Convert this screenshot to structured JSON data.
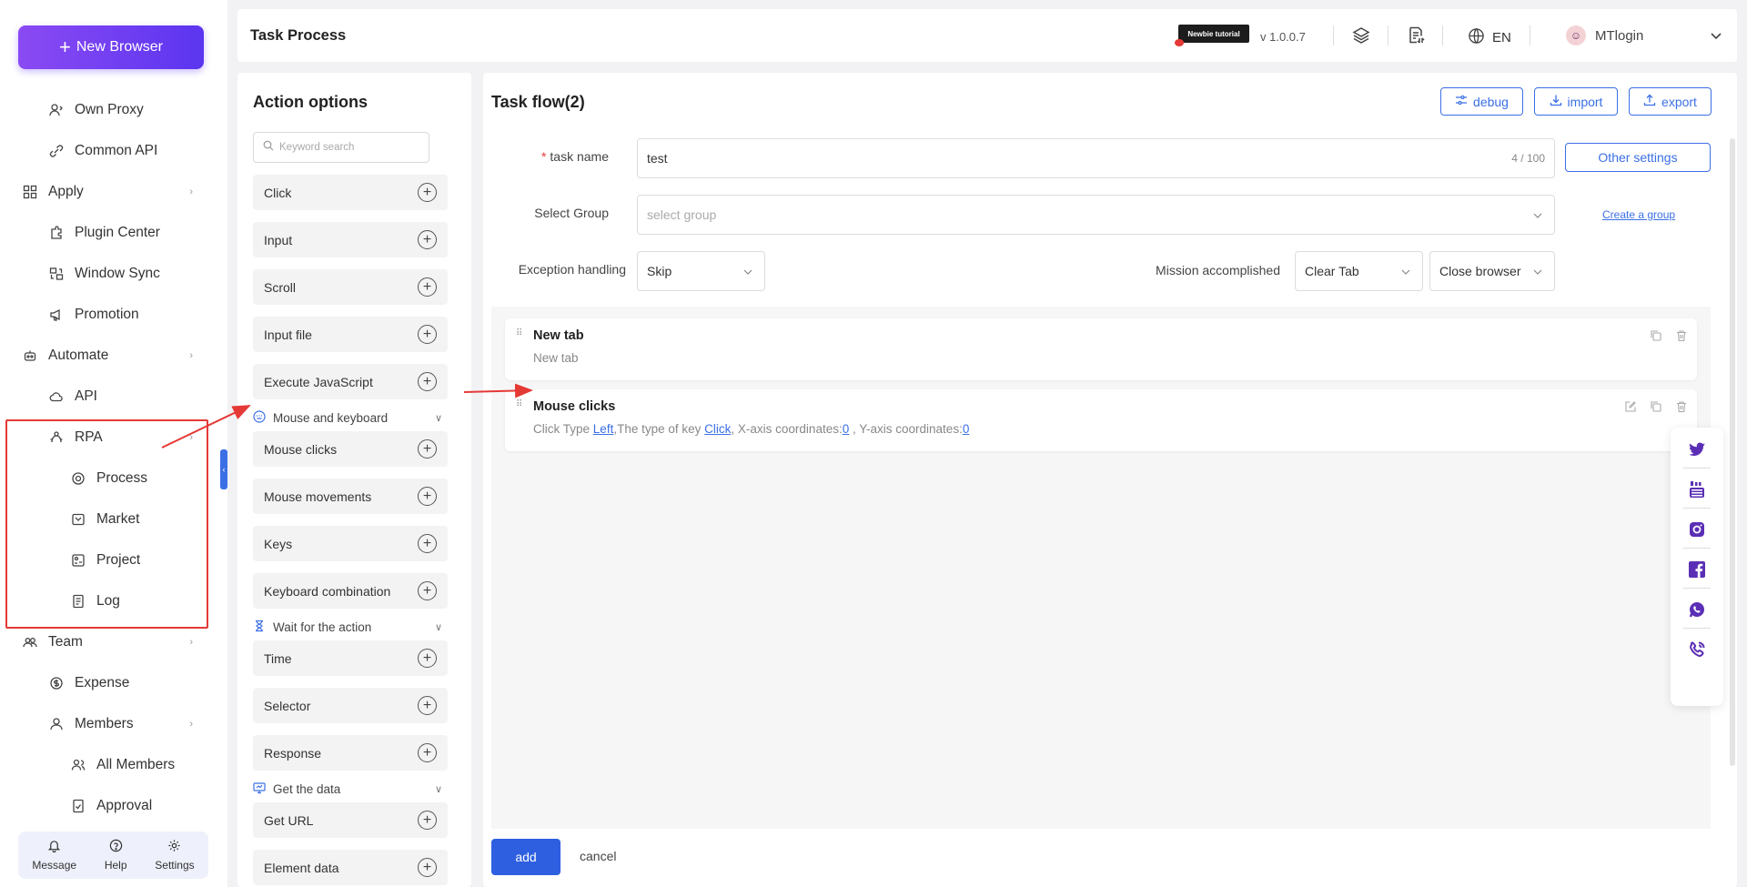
{
  "sidebar": {
    "new_browser": "New Browser",
    "items": [
      {
        "label": "Own Proxy",
        "level": 2
      },
      {
        "label": "Common API",
        "level": 2
      },
      {
        "label": "Apply",
        "level": 1
      },
      {
        "label": "Plugin Center",
        "level": 2
      },
      {
        "label": "Window Sync",
        "level": 2
      },
      {
        "label": "Promotion",
        "level": 2
      },
      {
        "label": "Automate",
        "level": 1
      },
      {
        "label": "API",
        "level": 2
      },
      {
        "label": "RPA",
        "level": 2
      },
      {
        "label": "Process",
        "level": 3
      },
      {
        "label": "Market",
        "level": 3
      },
      {
        "label": "Project",
        "level": 3
      },
      {
        "label": "Log",
        "level": 3
      },
      {
        "label": "Team",
        "level": 1
      },
      {
        "label": "Expense",
        "level": 2
      },
      {
        "label": "Members",
        "level": 2
      },
      {
        "label": "All Members",
        "level": 3
      },
      {
        "label": "Approval",
        "level": 3
      }
    ],
    "bottom": {
      "message": "Message",
      "help": "Help",
      "settings": "Settings"
    }
  },
  "header": {
    "title": "Task Process",
    "tutorial": "Newbie tutorial",
    "version": "v 1.0.0.7",
    "language": "EN",
    "username": "MTlogin"
  },
  "actions": {
    "title": "Action options",
    "search_placeholder": "Keyword search",
    "items": [
      "Click",
      "Input",
      "Scroll",
      "Input file",
      "Execute JavaScript"
    ],
    "section_mouse": "Mouse and keyboard",
    "mouse_items": [
      "Mouse clicks",
      "Mouse movements",
      "Keys",
      "Keyboard combination"
    ],
    "section_wait": "Wait for the action",
    "wait_items": [
      "Time",
      "Selector",
      "Response"
    ],
    "section_data": "Get the data",
    "data_items": [
      "Get URL",
      "Element data"
    ]
  },
  "flow": {
    "title": "Task flow(2)",
    "debug": "debug",
    "import": "import",
    "export": "export",
    "task_name_label": "task name",
    "task_name_value": "test",
    "task_name_count": "4 / 100",
    "other_settings": "Other settings",
    "select_group_label": "Select Group",
    "select_group_placeholder": "select group",
    "create_group": "Create a group",
    "exception_label": "Exception handling",
    "exception_value": "Skip",
    "mission_label": "Mission accomplished",
    "mission_value1": "Clear Tab",
    "mission_value2": "Close browser",
    "cards": [
      {
        "title": "New tab",
        "subtitle": "New tab"
      },
      {
        "title": "Mouse clicks",
        "sub_prefix": "Click Type",
        "click_type": "Left",
        "sub_mid1": ",The type of key",
        "key_type": "Click",
        "sub_mid2": ", X-axis coordinates:",
        "x": "0",
        "sub_mid3": ", Y-axis coordinates:",
        "y": "0"
      }
    ],
    "add": "add",
    "cancel": "cancel"
  },
  "colors": {
    "accent": "#3b6fe5",
    "brand_gradient_start": "#8a4af3",
    "brand_gradient_end": "#5b35f0",
    "highlight": "#e53935",
    "social": "#5b2fb5"
  },
  "social_icons": [
    "twitter-icon",
    "youtube-icon",
    "instagram-icon",
    "facebook-icon",
    "whatsapp-icon",
    "phone-icon"
  ]
}
